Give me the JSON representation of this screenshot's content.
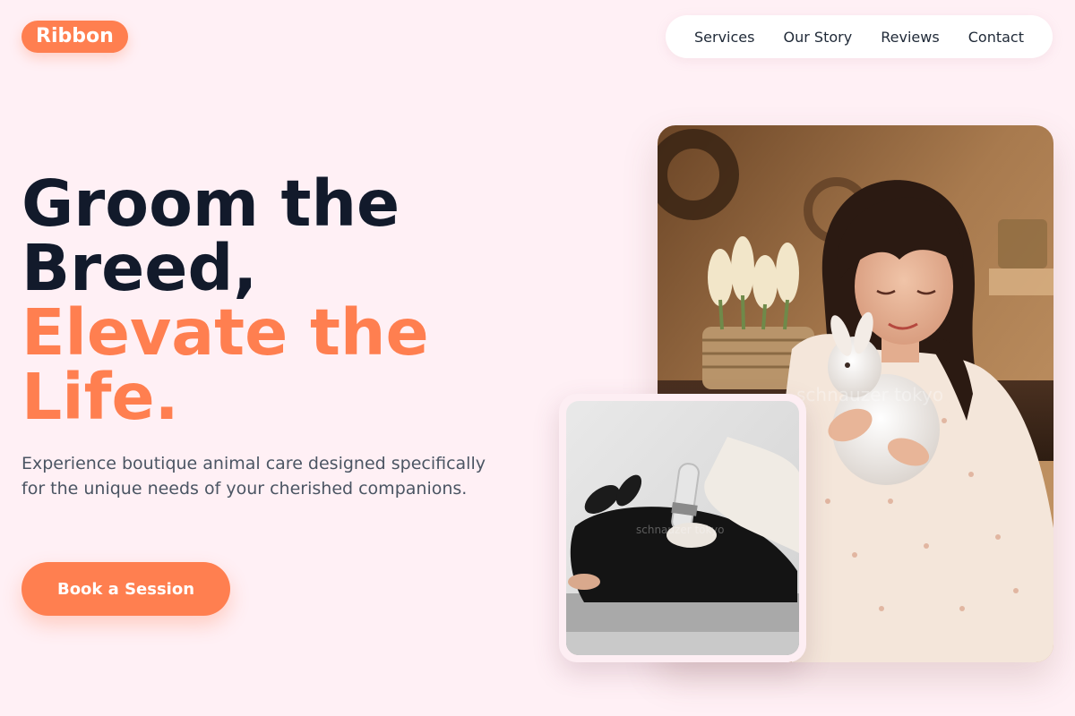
{
  "brand": {
    "name": "Ribbon"
  },
  "nav": {
    "items": [
      {
        "label": "Services"
      },
      {
        "label": "Our Story"
      },
      {
        "label": "Reviews"
      },
      {
        "label": "Contact"
      }
    ]
  },
  "hero": {
    "headline_line1": "Groom the",
    "headline_line2": "Breed,",
    "headline_accent1": "Elevate the",
    "headline_accent2": "Life.",
    "subtext": "Experience boutique animal care designed specifically for the unique needs of your cherished companions.",
    "cta_label": "Book a Session"
  },
  "images": {
    "main_watermark": "schnauzer tokyo",
    "inset_watermark": "schnauzer tokyo"
  },
  "colors": {
    "background": "#fff0f5",
    "accent": "#ff7f50",
    "headline_dark": "#121a2b",
    "body_text": "#4b5563"
  }
}
